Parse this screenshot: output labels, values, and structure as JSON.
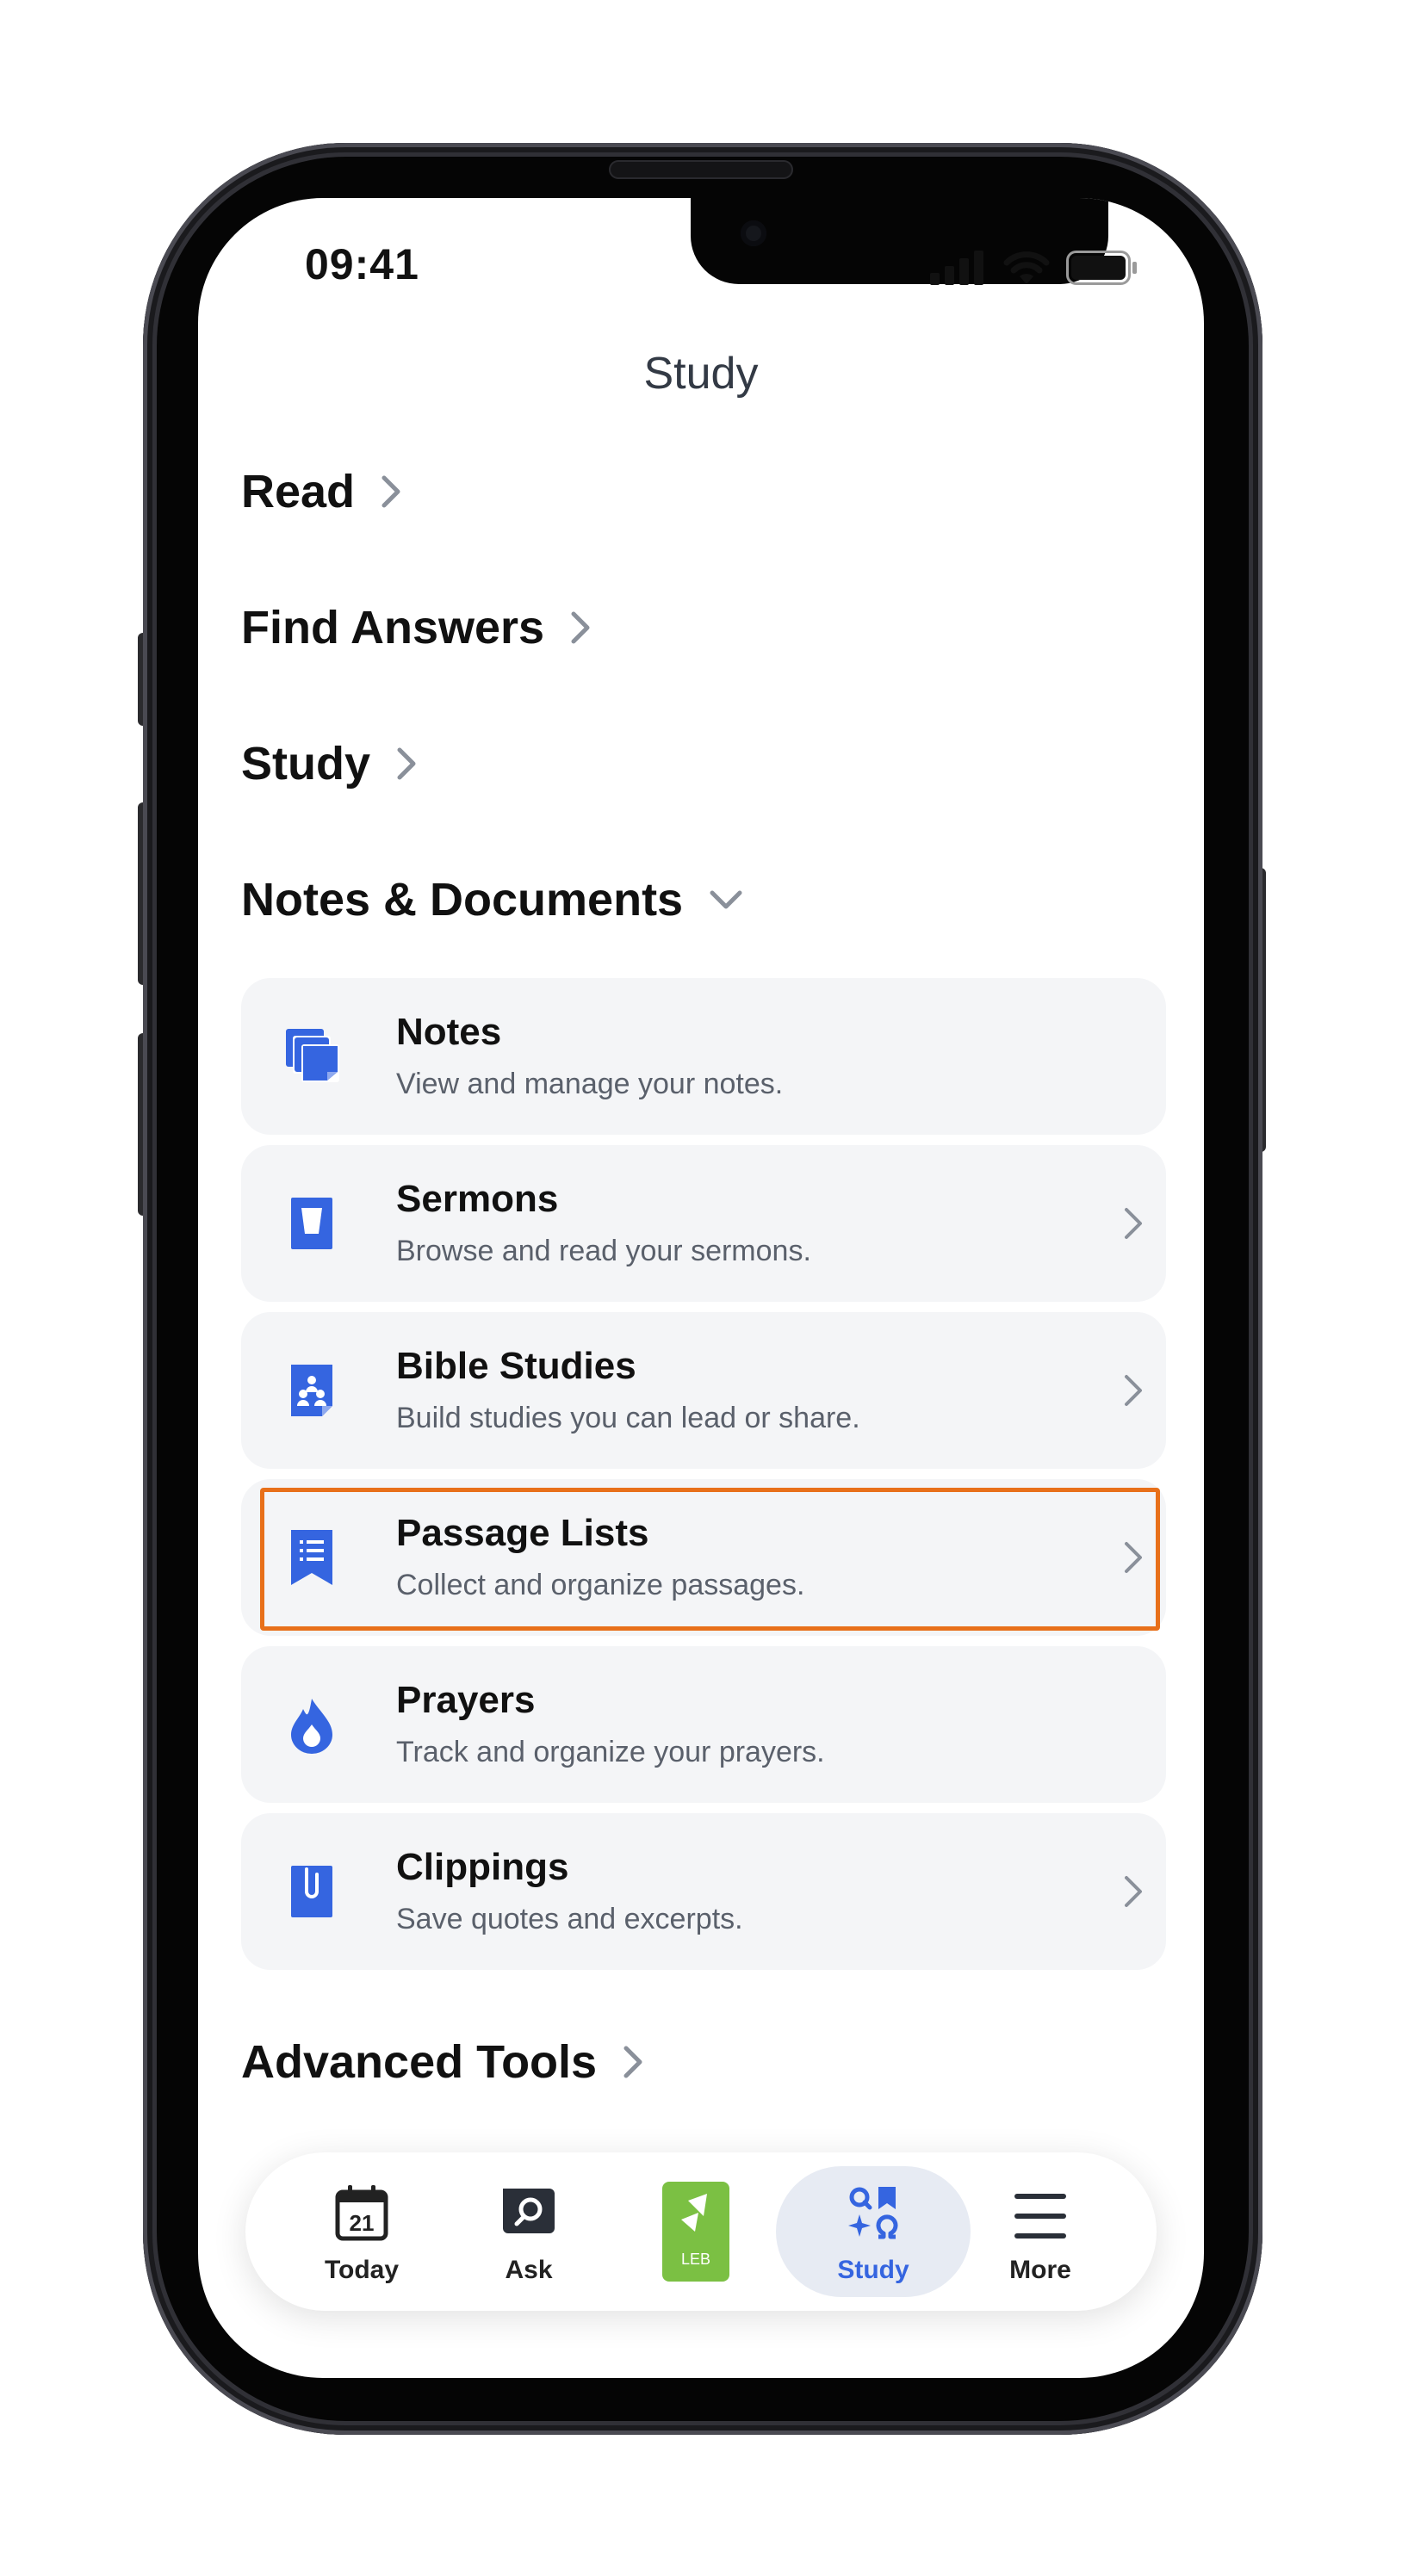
{
  "status": {
    "time": "09:41"
  },
  "header": {
    "title": "Study"
  },
  "sections": {
    "read": "Read",
    "find_answers": "Find Answers",
    "study": "Study",
    "notes_documents": "Notes & Documents",
    "advanced_tools": "Advanced Tools"
  },
  "cards": [
    {
      "title": "Notes",
      "subtitle": "View and manage your notes.",
      "icon": "notes-icon"
    },
    {
      "title": "Sermons",
      "subtitle": "Browse and read your sermons.",
      "icon": "sermon-icon"
    },
    {
      "title": "Bible Studies",
      "subtitle": "Build studies you can lead or share.",
      "icon": "bible-study-icon"
    },
    {
      "title": "Passage Lists",
      "subtitle": "Collect and organize passages.",
      "icon": "passage-list-icon"
    },
    {
      "title": "Prayers",
      "subtitle": "Track and organize your prayers.",
      "icon": "prayer-flame-icon"
    },
    {
      "title": "Clippings",
      "subtitle": "Save quotes and excerpts.",
      "icon": "clipping-icon"
    }
  ],
  "tabs": {
    "today": "Today",
    "today_date": "21",
    "ask": "Ask",
    "bible_badge": "LEB",
    "study": "Study",
    "more": "More"
  },
  "colors": {
    "accent": "#3565e0",
    "highlight": "#e8701a",
    "bible_green": "#7bc043",
    "card_bg": "#f4f5f7"
  }
}
